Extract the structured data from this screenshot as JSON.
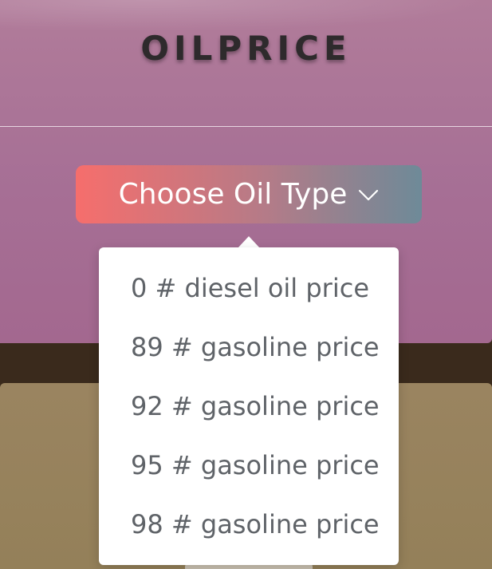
{
  "header": {
    "brand": "OILPRICE"
  },
  "selector": {
    "label": "Choose Oil Type",
    "icon": "chevron-down-icon"
  },
  "dropdown": {
    "items": [
      {
        "label": "0 # diesel oil price"
      },
      {
        "label": "89 # gasoline price"
      },
      {
        "label": "92 # gasoline price"
      },
      {
        "label": "95 # gasoline price"
      },
      {
        "label": "98 # gasoline price"
      }
    ]
  },
  "colors": {
    "hero_background": "#a66f95",
    "button_gradient_start": "#f66e6c",
    "button_gradient_end": "#6e8a98",
    "panel_background": "#9a8460",
    "menu_text": "#5f6368"
  }
}
